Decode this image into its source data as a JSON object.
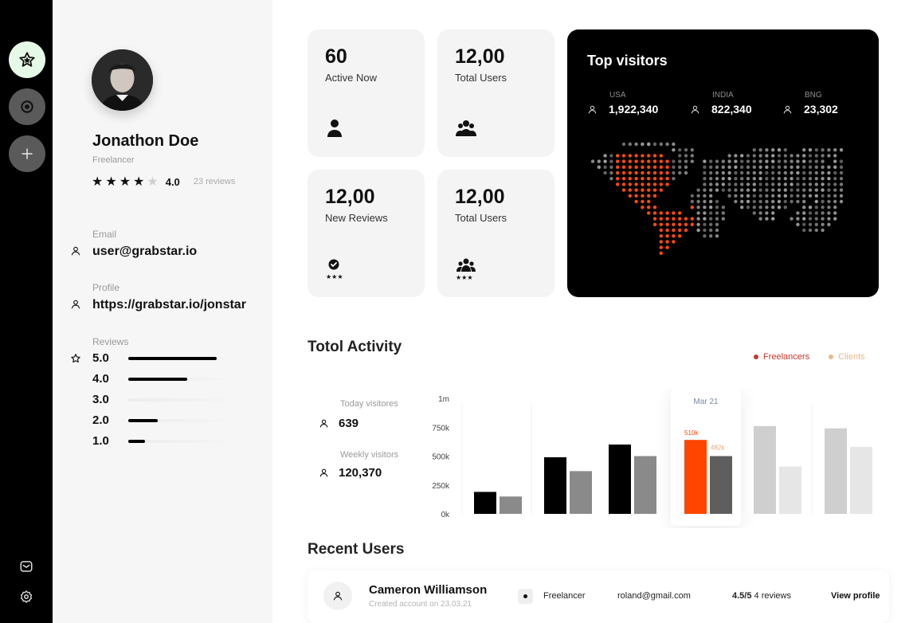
{
  "colors": {
    "accent": "#ff4500",
    "rail": "#000000",
    "active_nav": "#e6f8e6",
    "freelancers": "#c0392b",
    "clients": "#e8b98a"
  },
  "nav": {
    "items": [
      {
        "icon": "star-icon"
      },
      {
        "icon": "target-icon"
      },
      {
        "icon": "plus-icon"
      }
    ],
    "bottom": [
      {
        "icon": "mail-icon"
      },
      {
        "icon": "gear-icon"
      }
    ]
  },
  "profile": {
    "name": "Jonathon Doe",
    "role": "Freelancer",
    "stars": 4,
    "rating": "4.0",
    "reviews": "23 reviews",
    "email_label": "Email",
    "email": "user@grabstar.io",
    "profile_label": "Profile",
    "profile_url": "https://grabstar.io/jonstar",
    "reviews_label": "Reviews",
    "review_bars": [
      {
        "label": "5.0",
        "fraction": 0.88
      },
      {
        "label": "4.0",
        "fraction": 0.59
      },
      {
        "label": "3.0",
        "fraction": 0.0
      },
      {
        "label": "2.0",
        "fraction": 0.29
      },
      {
        "label": "1.0",
        "fraction": 0.17
      }
    ]
  },
  "stats": [
    {
      "value": "60",
      "label": "Active Now",
      "icon": "user-icon"
    },
    {
      "value": "12,00",
      "label": "Total Users",
      "icon": "users-group-icon"
    },
    {
      "value": "12,00",
      "label": "New Reviews",
      "icon": "review-badge-icon"
    },
    {
      "value": "12,00",
      "label": "Total Users",
      "icon": "users-rated-icon"
    }
  ],
  "top_visitors": {
    "title": "Top visitors",
    "countries": [
      {
        "code": "USA",
        "value": "1,922,340"
      },
      {
        "code": "INDIA",
        "value": "822,340"
      },
      {
        "code": "BNG",
        "value": "23,302"
      }
    ]
  },
  "activity": {
    "title": "Totol Activity",
    "legend": [
      "Freelancers",
      "Clients"
    ],
    "today_label": "Today visitores",
    "today_value": "639",
    "weekly_label": "Weekly visitors",
    "weekly_value": "120,370"
  },
  "chart_data": {
    "type": "bar",
    "yticks": [
      "1m",
      "750k",
      "500k",
      "250k",
      "0k"
    ],
    "ylim": [
      0,
      1000000
    ],
    "groups": [
      {
        "a": 190000,
        "b": 150000
      },
      {
        "a": 490000,
        "b": 370000
      },
      {
        "a": 600000,
        "b": 500000
      },
      {
        "a": 640000,
        "b": 500000,
        "highlight": true,
        "tooltip": "Mar 21",
        "a_label": "510k",
        "b_label": "482k"
      },
      {
        "a": 760000,
        "b": 410000
      },
      {
        "a": 740000,
        "b": 580000
      }
    ]
  },
  "recent": {
    "title": "Recent Users",
    "users": [
      {
        "name": "Cameron Williamson",
        "created": "Created account on 23.03.21",
        "role": "Freelancer",
        "email": "roland@gmail.com",
        "score": "4.5/5",
        "reviews": "4 reviews",
        "action": "View profile"
      }
    ]
  }
}
